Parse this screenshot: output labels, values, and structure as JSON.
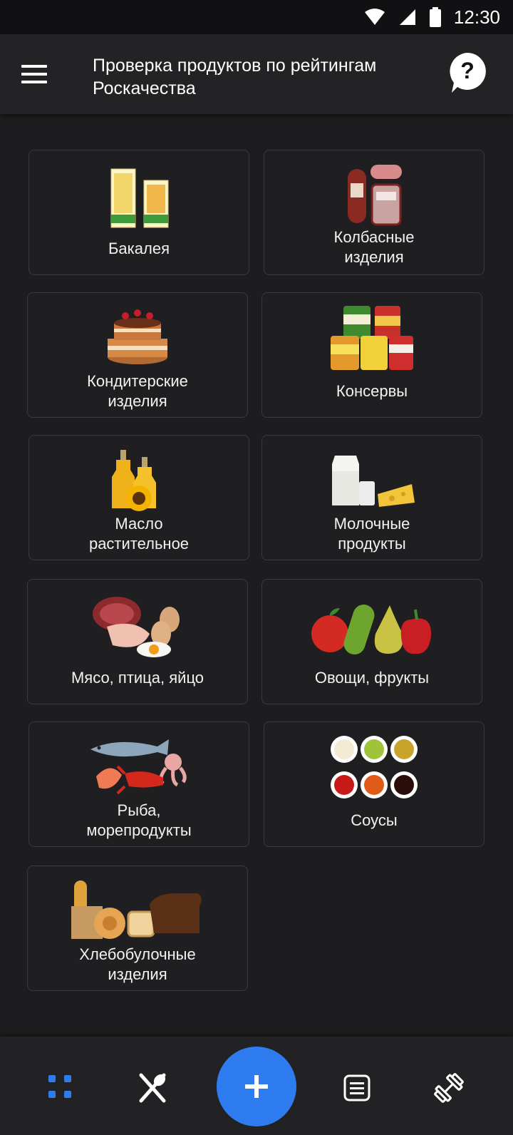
{
  "status_bar": {
    "time": "12:30"
  },
  "app_bar": {
    "title": "Проверка продуктов по рейтингам Роскачества",
    "menu_icon": "menu-icon",
    "help_icon": "help-icon"
  },
  "categories": [
    {
      "label": "Бакалея",
      "icon": "pasta-packages"
    },
    {
      "label": "Колбасные изделия",
      "icon": "sausages"
    },
    {
      "label": "Кондитерские изделия",
      "icon": "cake"
    },
    {
      "label": "Консервы",
      "icon": "cans"
    },
    {
      "label": "Масло растительное",
      "icon": "oil-sunflower"
    },
    {
      "label": "Молочные продукты",
      "icon": "milk-cheese"
    },
    {
      "label": "Мясо, птица, яйцо",
      "icon": "meat-eggs"
    },
    {
      "label": "Овощи, фрукты",
      "icon": "vegetables-fruits"
    },
    {
      "label": "Рыба, морепродукты",
      "icon": "fish-seafood"
    },
    {
      "label": "Соусы",
      "icon": "sauces"
    },
    {
      "label": "Хлебобулочные изделия",
      "icon": "bread"
    }
  ],
  "bottom_nav": {
    "items": [
      "grid-icon",
      "utensils-icon",
      "add-icon",
      "list-icon",
      "dumbbell-icon"
    ],
    "accent": "#2f7bf0"
  }
}
